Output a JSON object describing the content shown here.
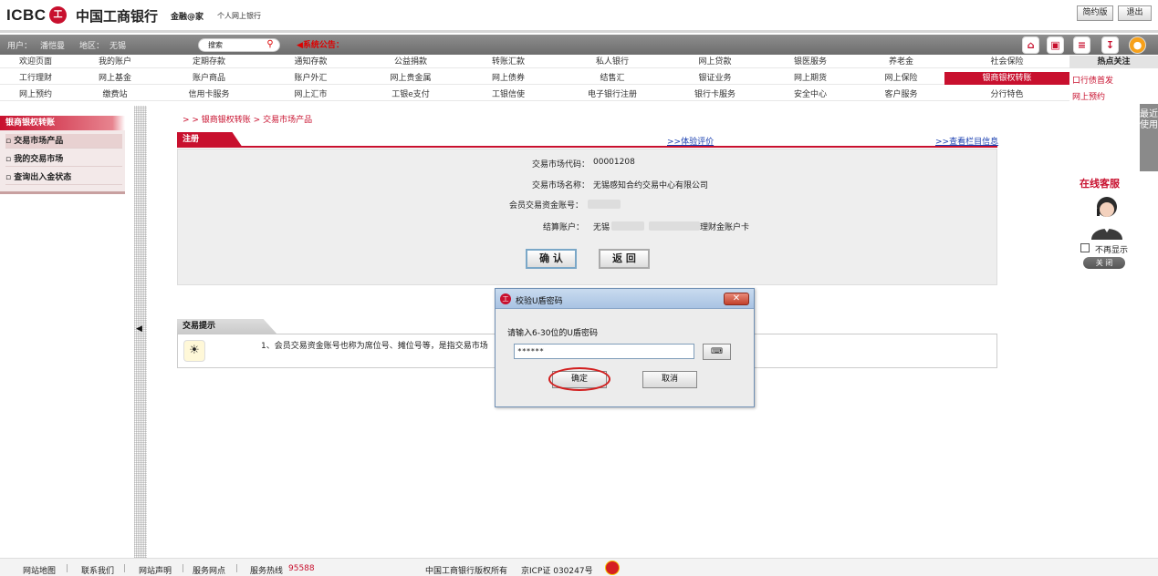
{
  "header": {
    "logo_en": "ICBC",
    "logo_mark": "工",
    "bank_name": "中国工商银行",
    "brand": "金融@家",
    "subtitle": "个人网上银行",
    "simple_btn": "简约版",
    "logout_btn": "退出"
  },
  "infobar": {
    "user": "用户：",
    "user_name": "潘恺曼",
    "region": "地区：",
    "region_name": "无锡",
    "search_placeholder": "搜索",
    "notice": "◀系统公告："
  },
  "nav": {
    "rows": [
      [
        "欢迎页面",
        "我的账户",
        "定期存款",
        "通知存款",
        "公益捐款",
        "转账汇款",
        "私人银行",
        "网上贷款",
        "银医服务",
        "养老金",
        "社会保险"
      ],
      [
        "工行理财",
        "网上基金",
        "账户商品",
        "账户外汇",
        "网上贵金属",
        "网上债券",
        "结售汇",
        "银证业务",
        "网上期货",
        "网上保险",
        "银商银权转账"
      ],
      [
        "网上预约",
        "缴费站",
        "信用卡服务",
        "网上汇市",
        "工银e支付",
        "工银信使",
        "电子银行注册",
        "银行卡服务",
        "安全中心",
        "客户服务",
        "分行特色"
      ]
    ],
    "active_label": "银商银权转账"
  },
  "hot": {
    "title": "热点关注",
    "items": [
      "口行债首发",
      "网上预约"
    ]
  },
  "sidebar": {
    "title": "银商银权转账",
    "items": [
      {
        "label": "交易市场产品"
      },
      {
        "label": "我的交易市场"
      },
      {
        "label": "查询出入金状态"
      }
    ]
  },
  "main": {
    "breadcrumb": "> > 银商银权转账 > 交易市场产品",
    "tab_label": "注册",
    "link_rate": ">>体验评价",
    "link_info": ">>查看栏目信息",
    "fields": {
      "market_code_label": "交易市场代码：",
      "market_code": "00001208",
      "market_name_label": "交易市场名称：",
      "market_name": "无锡感知合约交易中心有限公司",
      "member_acct_label": "会员交易资金账号：",
      "settle_label": "结算账户：",
      "settle_prefix": "无锡",
      "settle_suffix": "理财金账户卡"
    },
    "confirm_btn": "确 认",
    "back_btn": "返 回",
    "tips_title": "交易提示",
    "tips_text": "1、会员交易资金账号也称为席位号、摊位号等，是指交易市场"
  },
  "right": {
    "side_tab": "最近使用",
    "online": "在线客服",
    "no_show": "不再显示",
    "close": "关 闭"
  },
  "dialog": {
    "title": "校验U盾密码",
    "prompt": "请输入6-30位的U盾密码",
    "password_value": "******",
    "ok": "确定",
    "cancel": "取消"
  },
  "footer": {
    "sitemap": "网站地图",
    "contact": "联系我们",
    "statement": "网站声明",
    "outlets": "服务网点",
    "hotline_label": "服务热线",
    "hotline": "95588",
    "copyright": "中国工商银行版权所有",
    "icp": "京ICP证 030247号"
  }
}
